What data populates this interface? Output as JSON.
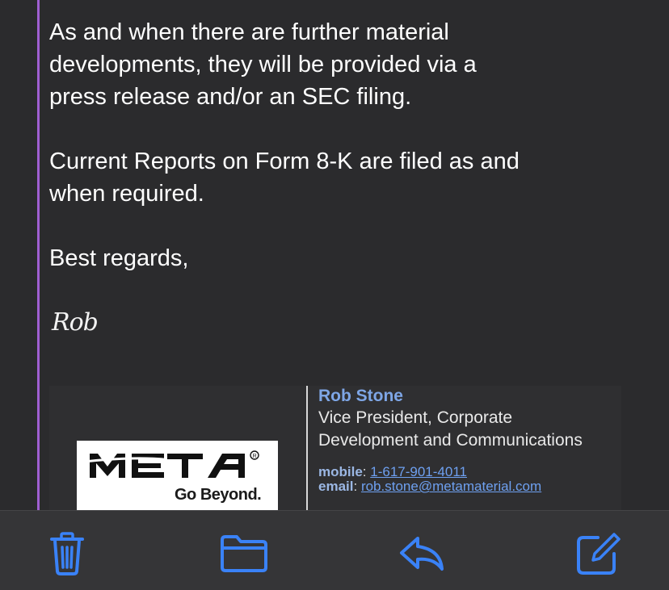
{
  "message": {
    "paragraph1": [
      "As and when there are further material",
      "developments, they will be provided via a",
      "press release and/or an SEC filing."
    ],
    "paragraph2": [
      "Current Reports on Form 8-K are filed as and",
      "when required."
    ],
    "closing": "Best regards,",
    "script_signature": "Rob"
  },
  "signature": {
    "logo": {
      "wordmark": "META",
      "registered": "®",
      "tagline": "Go Beyond."
    },
    "name": "Rob Stone",
    "title": "Vice President, Corporate Development and Communications",
    "mobile_label": "mobile",
    "mobile_value": "1-617-901-4011",
    "email_label": "email",
    "email_value": "rob.stone@metamaterial.com"
  },
  "toolbar": {
    "items": [
      {
        "icon": "trash-icon"
      },
      {
        "icon": "folder-icon"
      },
      {
        "icon": "reply-icon"
      },
      {
        "icon": "compose-icon"
      }
    ],
    "accent": "#3a82f7"
  },
  "colors": {
    "background": "#2b2b2d",
    "quote_bar": "#a05fd2",
    "link": "#6ea0f0"
  }
}
